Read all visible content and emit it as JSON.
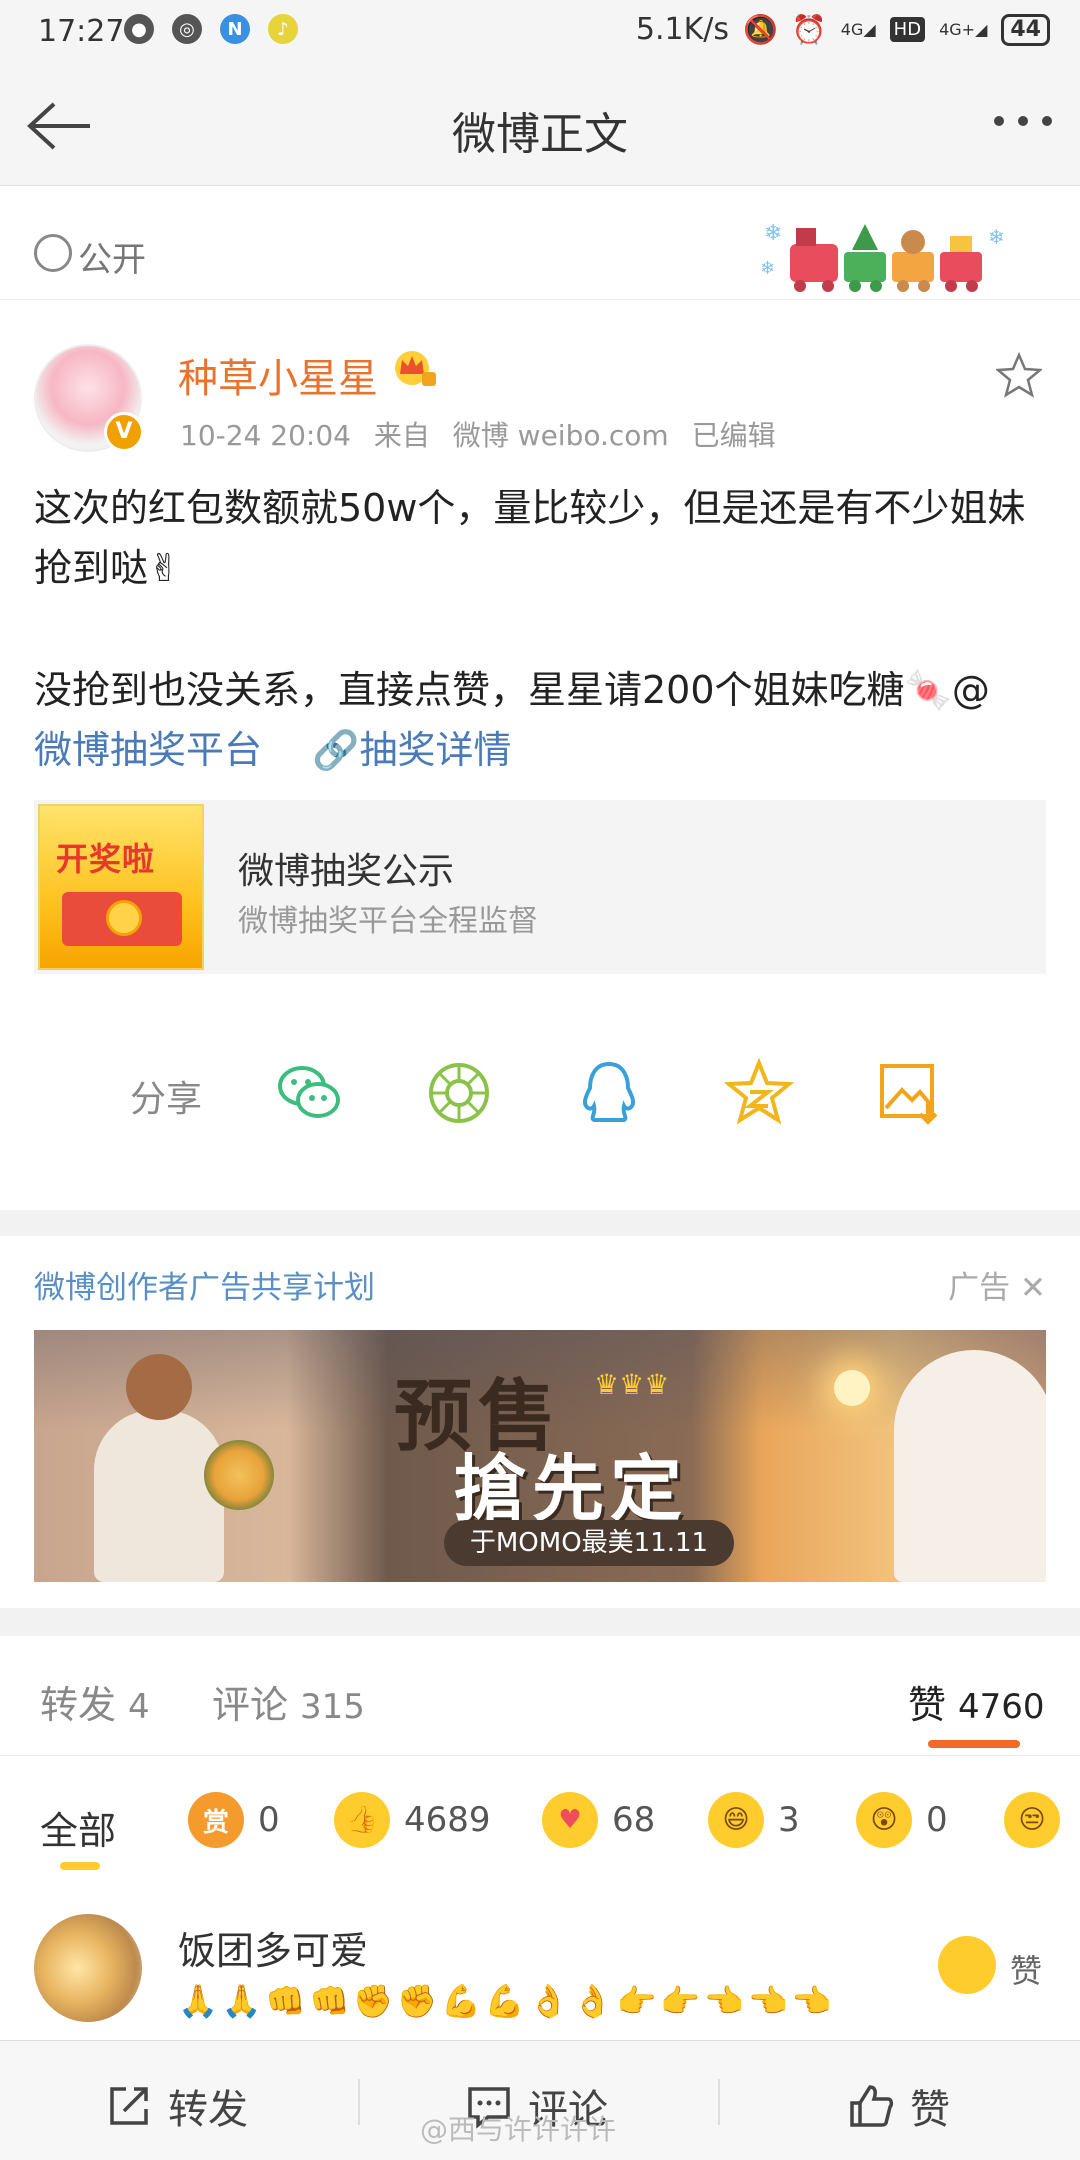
{
  "status_bar": {
    "time": "17:27",
    "net_speed": "5.1K/s",
    "signal1": "4G",
    "hd": "HD",
    "signal2": "4G+",
    "battery": "44"
  },
  "header": {
    "title": "微博正文"
  },
  "visibility": {
    "label": "公开"
  },
  "post": {
    "author": "种草小星星",
    "date": "10-24 20:04",
    "source_prefix": "来自",
    "source": "微博 weibo.com",
    "edited": "已编辑",
    "text1": "这次的红包数额就50w个，量比较少，但是还是有不少姐妹抢到哒✌",
    "text2": "没抢到也没关系，直接点赞，星星请200个姐妹吃糖🍬@",
    "mention": "微博抽奖平台",
    "detail_link": "抽奖详情"
  },
  "card": {
    "thumb_text": "开奖啦",
    "title": "微博抽奖公示",
    "subtitle": "微博抽奖平台全程监督"
  },
  "share": {
    "label": "分享"
  },
  "ad": {
    "title": "微博创作者广告共享计划",
    "tag": "广告",
    "headline1": "预售",
    "headline2": "搶先定",
    "pill": "于MOMO最美11.11"
  },
  "tabs": {
    "repost_label": "转发",
    "repost_count": "4",
    "comment_label": "评论",
    "comment_count": "315",
    "like_label": "赞",
    "like_count": "4760"
  },
  "reactions": {
    "all": "全部",
    "items": [
      {
        "icon": "赏",
        "count": "0"
      },
      {
        "icon": "like",
        "count": "4689"
      },
      {
        "icon": "heart",
        "count": "68"
      },
      {
        "icon": "laugh",
        "count": "3"
      },
      {
        "icon": "surprise",
        "count": "0"
      }
    ]
  },
  "comment": {
    "user": "饭团多可爱",
    "emojis": "🙏🙏👊👊✊✊💪💪👌👌👉👉👈👈👈",
    "like_label": "赞"
  },
  "bottom_bar": {
    "repost": "转发",
    "comment": "评论",
    "like": "赞"
  },
  "watermark": "@西与许许许许"
}
